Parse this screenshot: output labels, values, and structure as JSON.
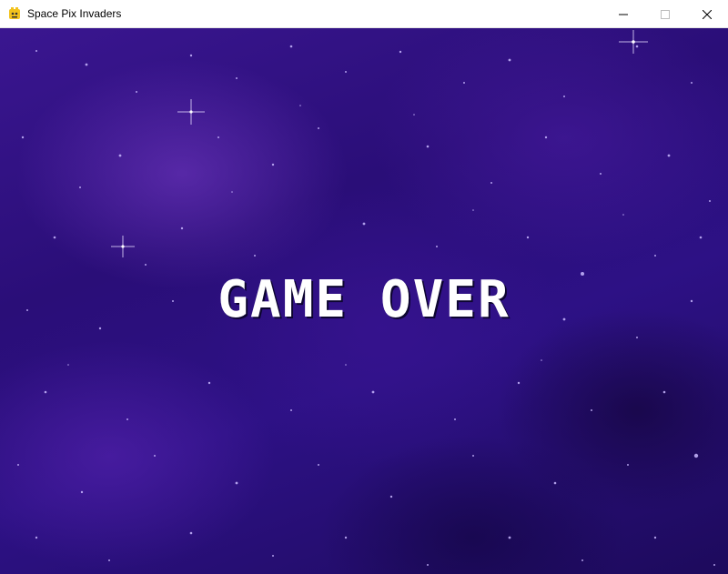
{
  "window": {
    "title": "Space Pix Invaders",
    "icon": "pygame-snake-icon",
    "controls": [
      "minimize-icon",
      "maximize-icon",
      "close-icon"
    ]
  },
  "game": {
    "message": "GAME OVER",
    "colors": {
      "background": "#2a0e78",
      "text": "#ffffff",
      "star": "#c9b8ff"
    }
  }
}
